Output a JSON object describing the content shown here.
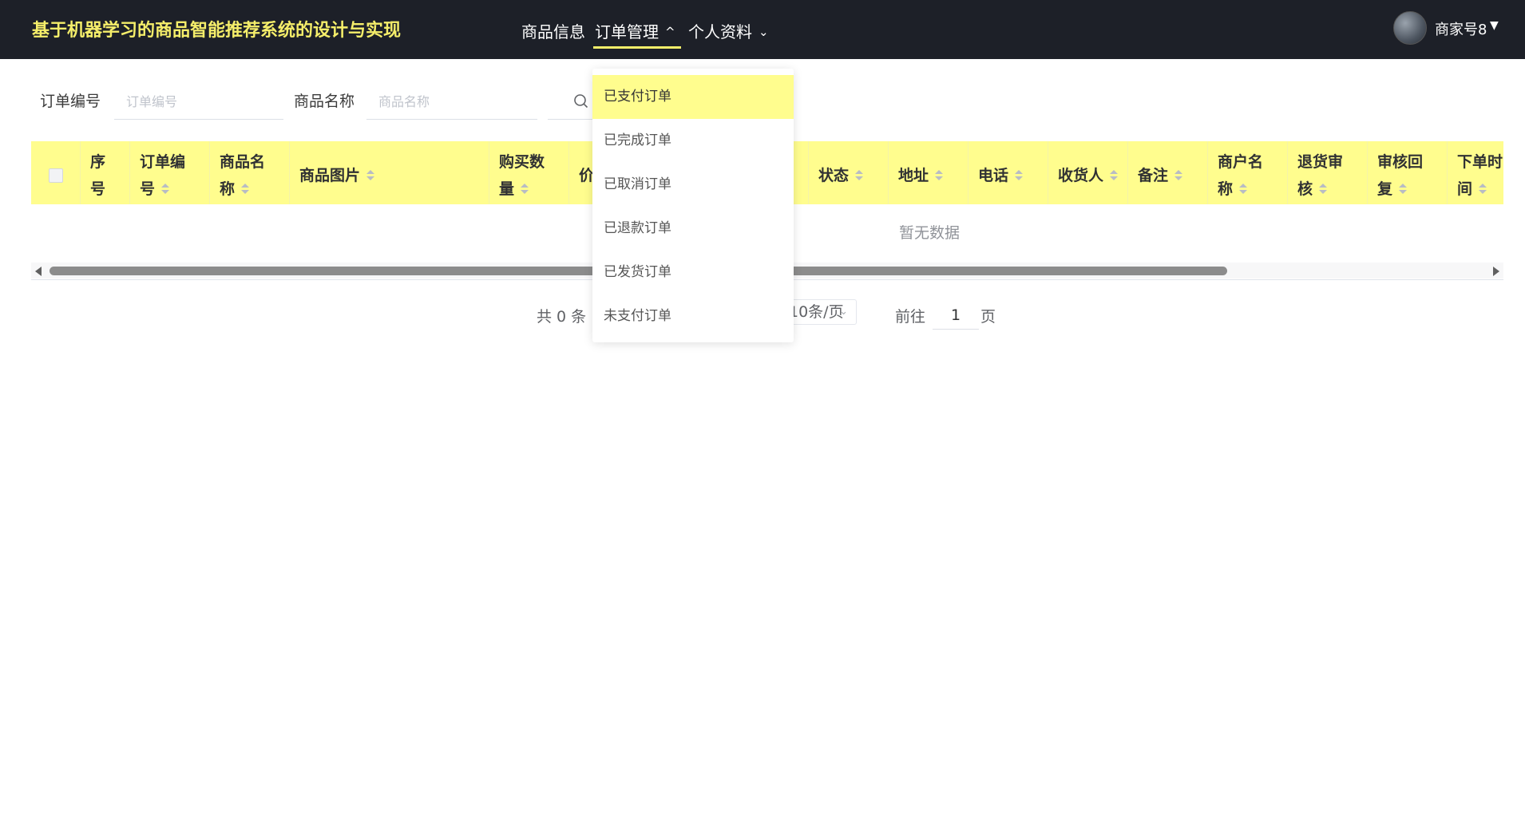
{
  "header": {
    "app_title": "基于机器学习的商品智能推荐系统的设计与实现",
    "nav": [
      {
        "label": "商品信息"
      },
      {
        "label": "订单管理",
        "chevron": "^"
      },
      {
        "label": "个人资料",
        "chevron": "⌄"
      }
    ],
    "user": {
      "name": "商家号8",
      "caret": "▼"
    }
  },
  "search": {
    "order_no_label": "订单编号",
    "order_no_placeholder": "订单编号",
    "product_name_label": "商品名称",
    "product_name_placeholder": "商品名称"
  },
  "table": {
    "columns": [
      {
        "label": "序号"
      },
      {
        "label": "订单编号"
      },
      {
        "label": "商品名称"
      },
      {
        "label": "商品图片"
      },
      {
        "label": "购买数量"
      },
      {
        "label": "价格"
      },
      {
        "label": "状态"
      },
      {
        "label": "地址"
      },
      {
        "label": "电话"
      },
      {
        "label": "收货人"
      },
      {
        "label": "备注"
      },
      {
        "label": "商户名称"
      },
      {
        "label": "退货审核"
      },
      {
        "label": "审核回复"
      },
      {
        "label": "下单时间"
      }
    ],
    "empty_text": "暂无数据"
  },
  "pagination": {
    "total": "共 0 条",
    "page_size": "10条/页",
    "goto_label": "前往",
    "page_value": "1",
    "page_suffix": "页"
  },
  "dropdown": {
    "items": [
      {
        "label": "已支付订单",
        "active": true
      },
      {
        "label": "已完成订单"
      },
      {
        "label": "已取消订单"
      },
      {
        "label": "已退款订单"
      },
      {
        "label": "已发货订单"
      },
      {
        "label": "未支付订单"
      }
    ]
  },
  "colors": {
    "topbar_bg": "#1d2028",
    "accent_yellow": "#f5ee6a",
    "table_header_bg": "#fffd8e"
  }
}
